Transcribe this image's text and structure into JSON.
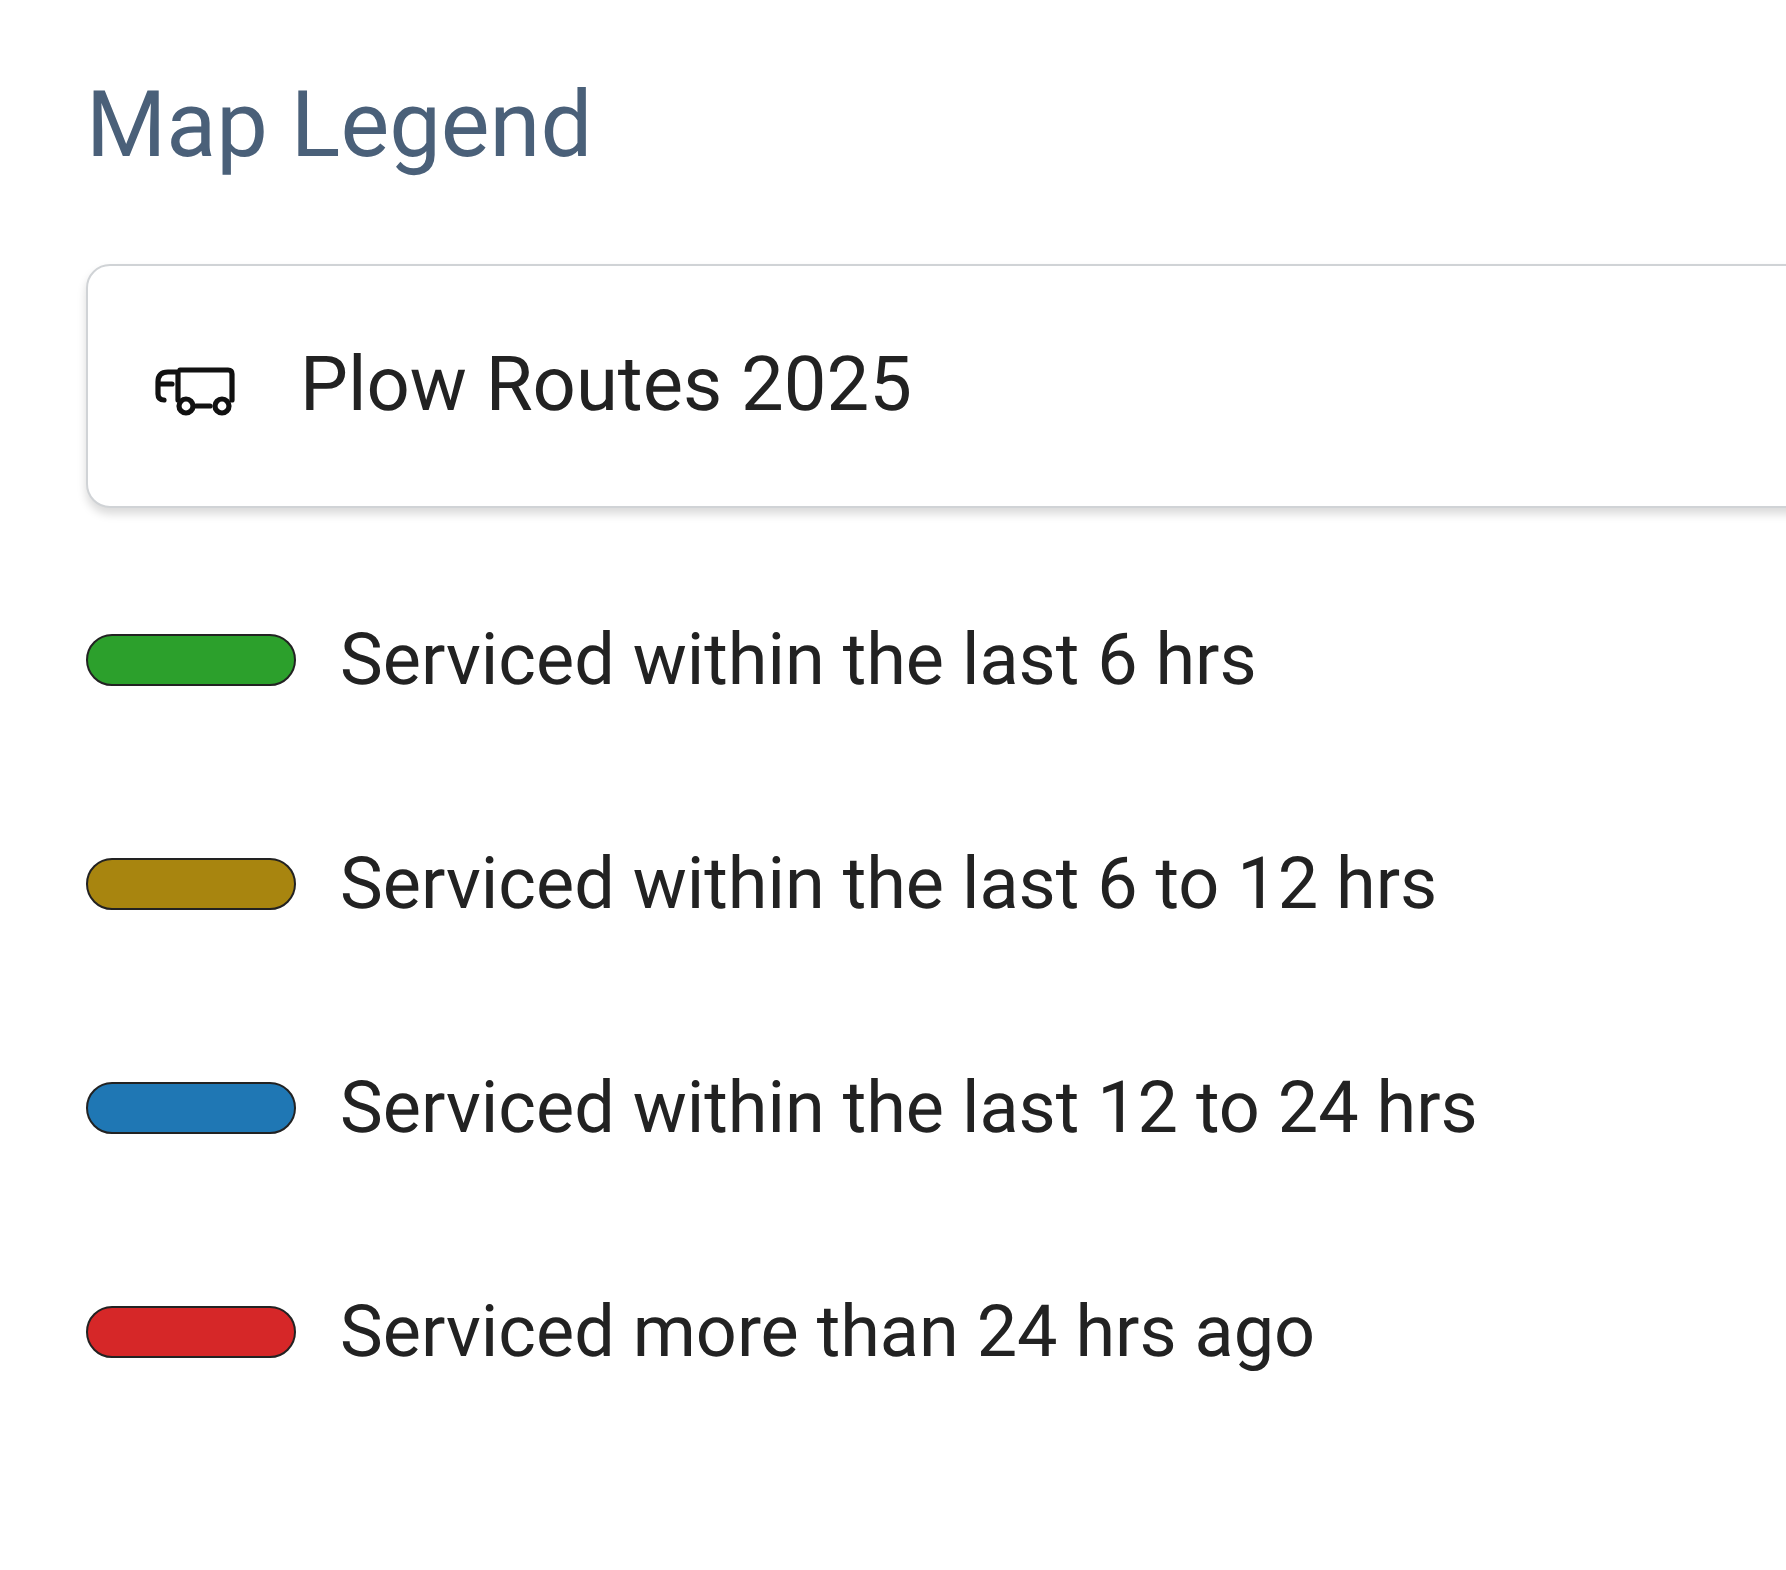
{
  "title": "Map Legend",
  "layer": {
    "name": "Plow Routes 2025"
  },
  "legend": [
    {
      "label": "Serviced within the last 6 hrs",
      "color": "#2ca02c"
    },
    {
      "label": "Serviced within the last 6 to 12 hrs",
      "color": "#a8850f"
    },
    {
      "label": "Serviced within the last 12 to 24 hrs",
      "color": "#1f77b4"
    },
    {
      "label": "Serviced more than 24 hrs ago",
      "color": "#d62728"
    }
  ]
}
